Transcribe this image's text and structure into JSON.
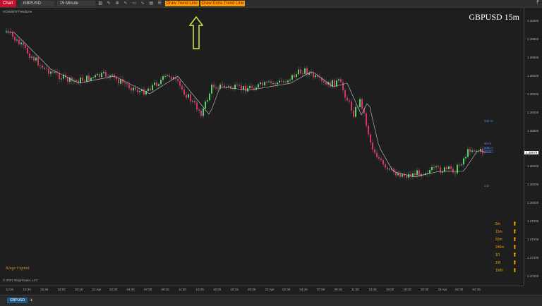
{
  "toolbar": {
    "chart_label": "Chart",
    "instrument": "GBPUSD",
    "timeframe": "15 Minute",
    "draw_trend_line": "Draw Trend Line",
    "draw_extra_trend_line": "Draw Extra Trend Line",
    "f_label": "F"
  },
  "chart": {
    "symbol_title": "GBPUSD 15m",
    "indicator_name": "VCMultiTFTrendLine",
    "copyright": "© 2021 NinjaTrader, LLC",
    "logo_text": "Kings Capital",
    "current_price": "1.38579",
    "price_labels": [
      "1.40000",
      "1.39800",
      "1.39600",
      "1.39400",
      "1.39200",
      "1.39000",
      "1.38800",
      "1.38600",
      "1.38400",
      "1.38200",
      "1.38000",
      "1.37800",
      "1.37600",
      "1.37400",
      "1.37200"
    ],
    "time_labels": [
      "11:15",
      "13:30",
      "15:45",
      "18:00",
      "20:15",
      "21 Apr",
      "02:30",
      "04:45",
      "07:00",
      "09:15",
      "11:30",
      "13:45",
      "16:00",
      "18:15",
      "20:30",
      "22 Apr",
      "02:30",
      "04:45",
      "07:00",
      "09:15",
      "11:30",
      "13:45",
      "16:00",
      "18:15",
      "20:30",
      "23 Apr",
      "02:30",
      "04:45"
    ],
    "level_tags": [
      "240 m",
      "60 m",
      "1 D",
      "15 m",
      "1 D"
    ],
    "accent_color": "#f0a000"
  },
  "mtf_table": [
    {
      "label": "5m",
      "direction": "up"
    },
    {
      "label": "15m",
      "direction": "up"
    },
    {
      "label": "60m",
      "direction": "up"
    },
    {
      "label": "240m",
      "direction": "up"
    },
    {
      "label": "1D",
      "direction": "up"
    },
    {
      "label": "1W",
      "direction": "up"
    },
    {
      "label": "1MN",
      "direction": "up"
    }
  ],
  "tab": {
    "label": "GBPUSD"
  },
  "icons": {
    "arrow": "up-arrow-icon",
    "add": "plus-icon"
  }
}
